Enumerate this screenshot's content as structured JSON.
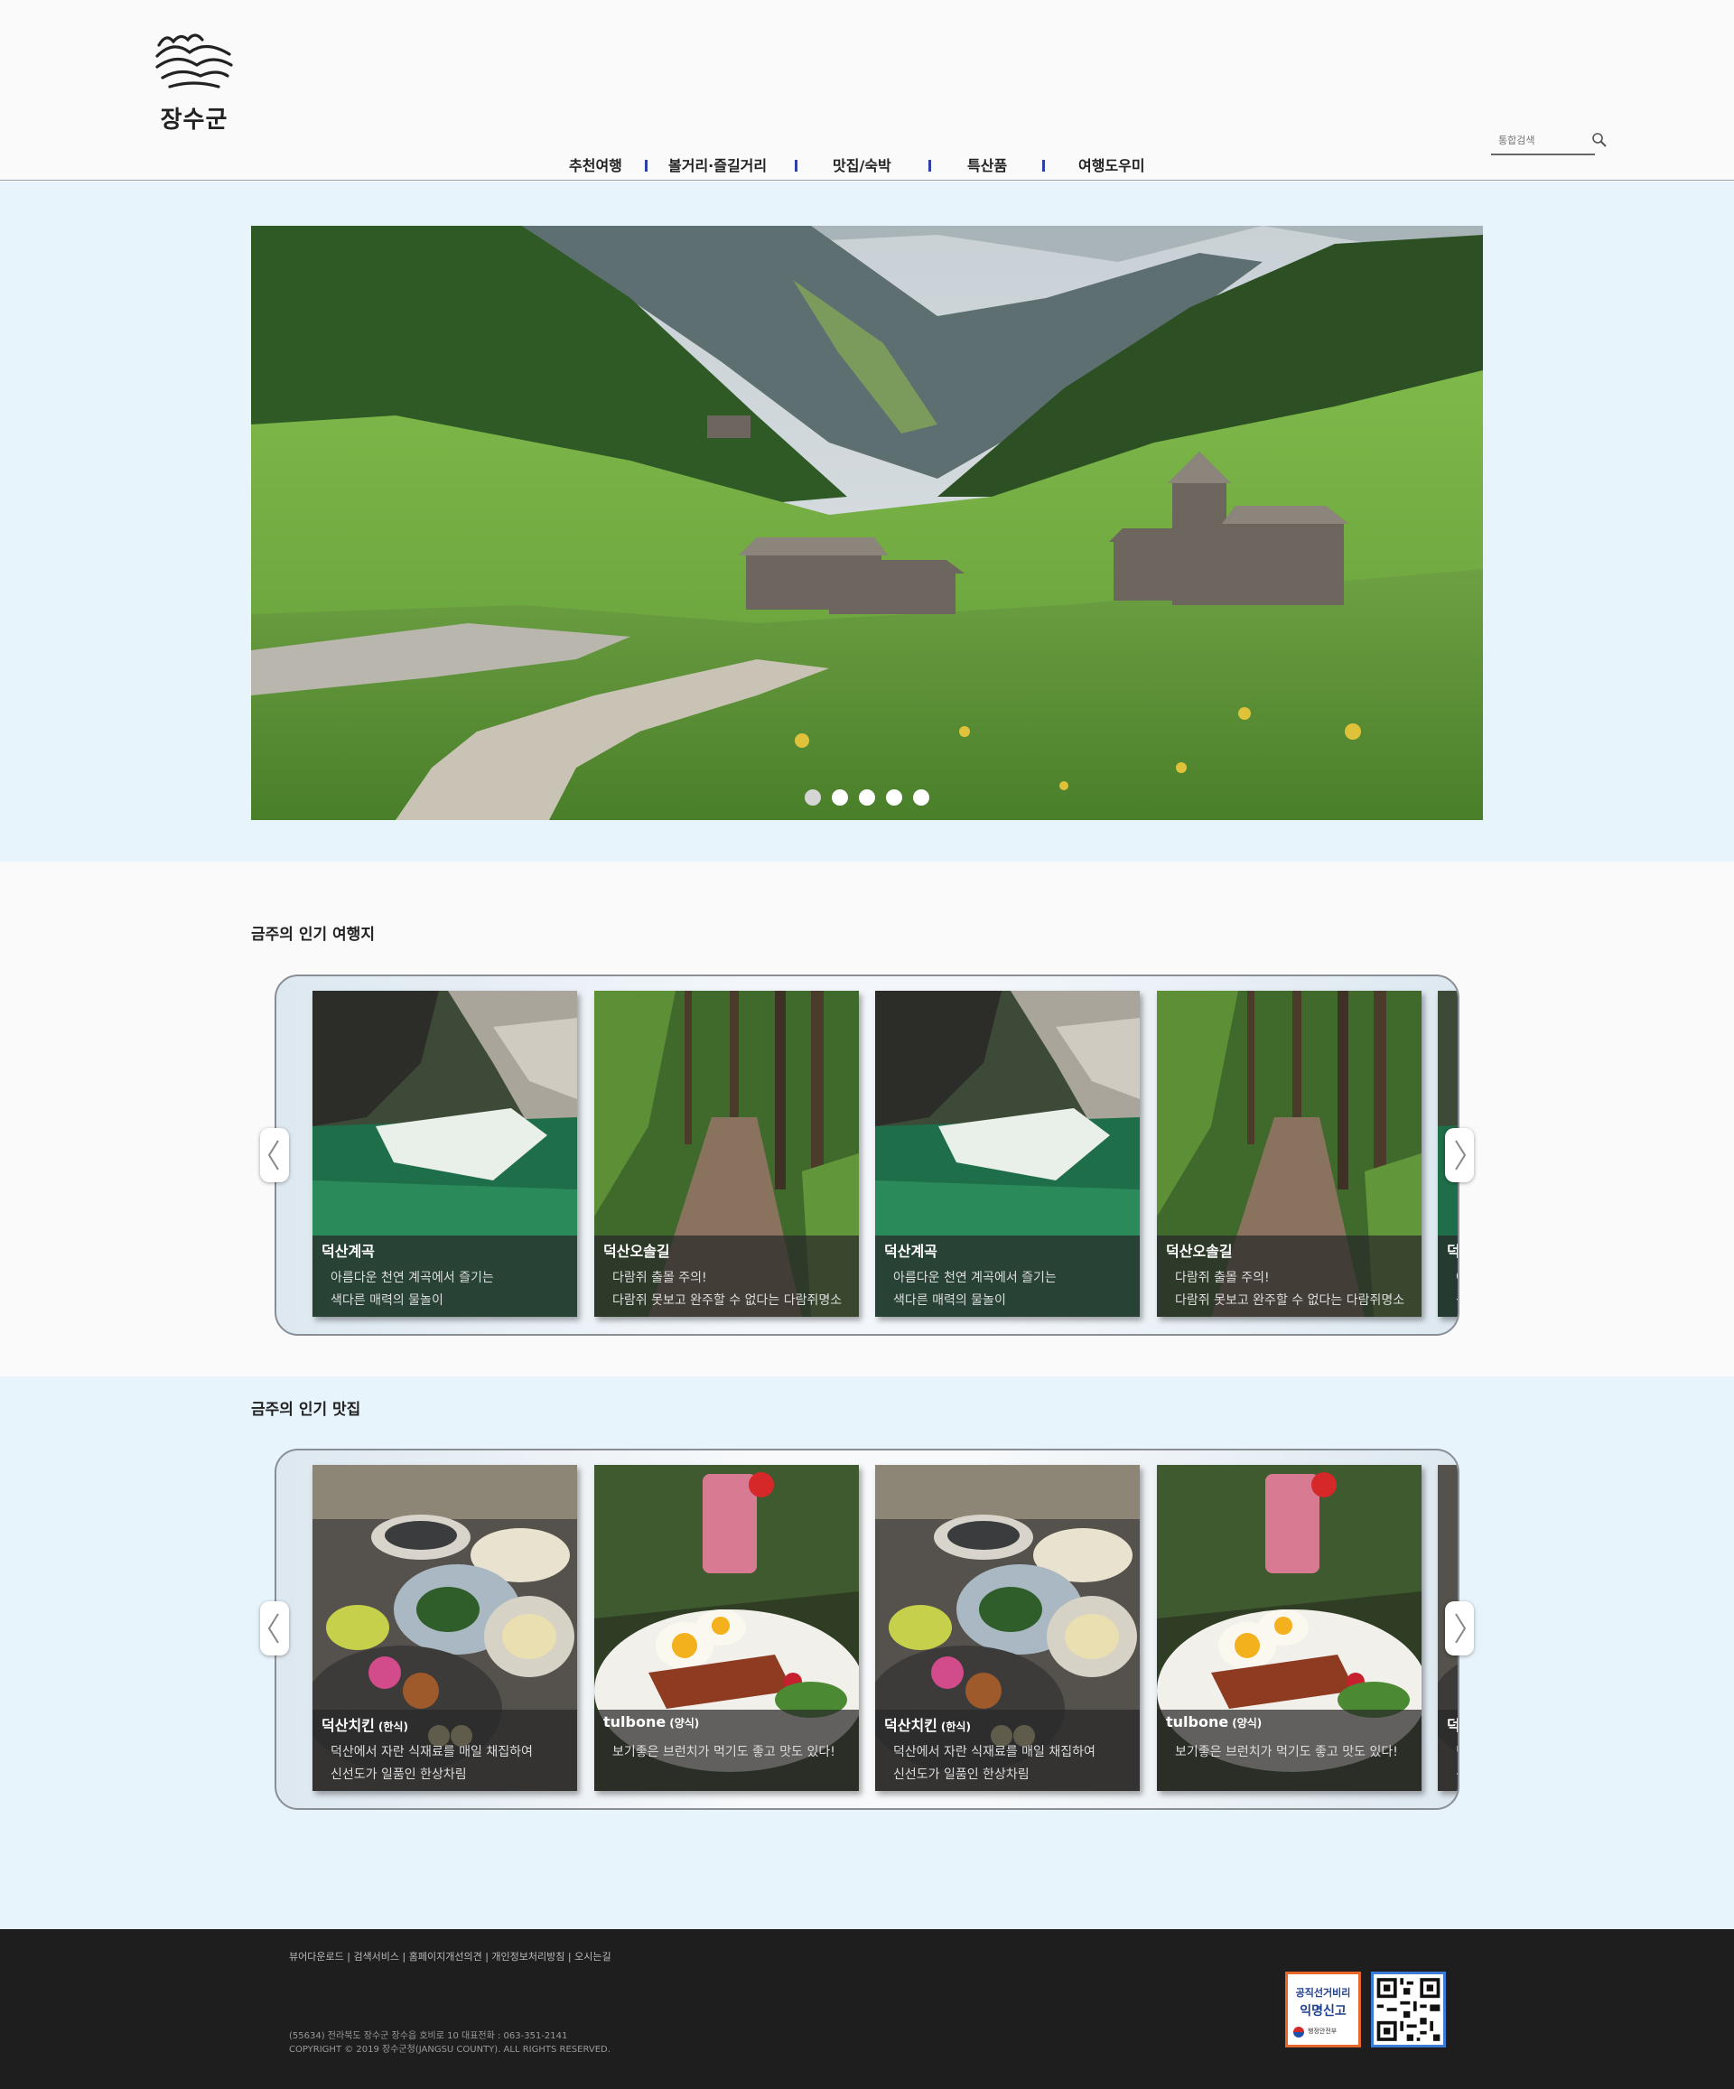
{
  "header": {
    "logo_text": "장수군",
    "search_placeholder": "통합검색",
    "nav": [
      "추천여행",
      "볼거리·즐길거리",
      "맛집/숙박",
      "특산품",
      "여행도우미"
    ]
  },
  "hero": {
    "slide_count": 5,
    "active_slide": 1
  },
  "travel_section": {
    "title": "금주의 인기 여행지",
    "cards": [
      {
        "title": "덕산계곡",
        "line1": "아름다운 천연 계곡에서 즐기는",
        "line2": "색다른 매력의 물놀이"
      },
      {
        "title": "덕산오솔길",
        "line1": "다람쥐 출몰 주의!",
        "line2": "다람쥐 못보고 완주할 수 없다는 다람쥐명소"
      },
      {
        "title": "덕산계곡",
        "line1": "아름다운 천연 계곡에서 즐기는",
        "line2": "색다른 매력의 물놀이"
      },
      {
        "title": "덕산오솔길",
        "line1": "다람쥐 출몰 주의!",
        "line2": "다람쥐 못보고 완주할 수 없다는 다람쥐명소"
      },
      {
        "title": "덕",
        "line1": "아",
        "line2": "색"
      }
    ]
  },
  "food_section": {
    "title": "금주의 인기 맛집",
    "cards": [
      {
        "title": "덕산치킨",
        "tag": "(한식)",
        "line1": "덕산에서 자란 식재료를 매일 채집하여",
        "line2": "신선도가 일품인 한상차림"
      },
      {
        "title": "tulbone",
        "tag": "(양식)",
        "line1": "보기좋은 브런치가 먹기도 좋고 맛도 있다!",
        "line2": ""
      },
      {
        "title": "덕산치킨",
        "tag": "(한식)",
        "line1": "덕산에서 자란 식재료를 매일 채집하여",
        "line2": "신선도가 일품인 한상차림"
      },
      {
        "title": "tulbone",
        "tag": "(양식)",
        "line1": "보기좋은 브런치가 먹기도 좋고 맛도 있다!",
        "line2": ""
      },
      {
        "title": "덕",
        "tag": "",
        "line1": "덕",
        "line2": "신"
      }
    ]
  },
  "footer": {
    "links": [
      "뷰어다운로드",
      "검색서비스",
      "홈페이지개선의견",
      "개인정보처리방침",
      "오시는길"
    ],
    "address": "(55634) 전라북도 장수군 장수읍 호비로 10 대표전화 : 063-351-2141",
    "copyright": "COPYRIGHT © 2019 장수군청(JANGSU COUNTY). ALL RIGHTS RESERVED.",
    "badge_line1": "공직선거비리",
    "badge_line2": "익명신고",
    "badge_org": "행정안전부"
  },
  "colors": {
    "nav_separator": "#2f3fa6",
    "light_band": "#e8f4fc",
    "footer_bg": "#1e1e1e",
    "badge_border": "#e8662a",
    "qr_border": "#3a7bd5"
  }
}
